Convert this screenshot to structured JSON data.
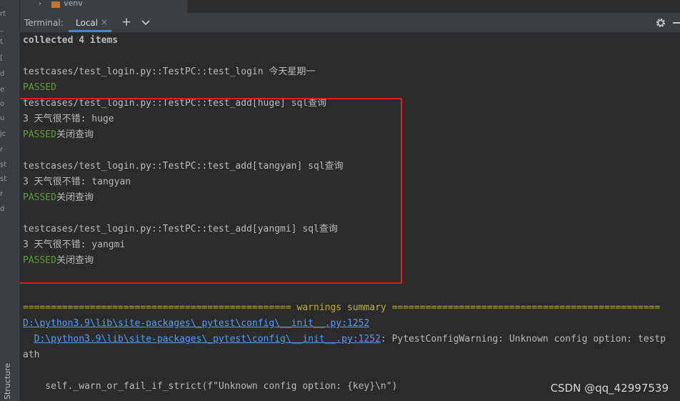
{
  "sidebar_fragments": [
    "rt",
    "_",
    "t",
    "[",
    "d",
    "e",
    "o",
    "u",
    "jc",
    "r",
    "st",
    "st",
    "r",
    "d"
  ],
  "structure_tab": "Structure",
  "project_tree": {
    "folder_name": "venv"
  },
  "tool_window": {
    "title": "Terminal:",
    "active_tab": "Local",
    "close_glyph": "×",
    "add_glyph": "+"
  },
  "terminal": {
    "lines": {
      "collected": "collected 4 items",
      "test1": "testcases/test_login.py::TestPC::test_login 今天星期一",
      "passed1": "PASSED",
      "test2": "testcases/test_login.py::TestPC::test_add[huge] sql查询",
      "weather2": "3 天气很不错: huge",
      "passed2": "PASSED",
      "close2": "关闭查询",
      "test3": "testcases/test_login.py::TestPC::test_add[tangyan] sql查询",
      "weather3": "3 天气很不错: tangyan",
      "passed3": "PASSED",
      "close3": "关闭查询",
      "test4": "testcases/test_login.py::TestPC::test_add[yangmi] sql查询",
      "weather4": "3 天气很不错: yangmi",
      "passed4": "PASSED",
      "close4": "关闭查询",
      "warn_rule_left": "================================================ ",
      "warn_title": "warnings summary",
      "warn_rule_right": " ================================================",
      "path_link1": "D:\\python3.9\\lib\\site-packages\\_pytest\\config\\__init__.py:1252",
      "path_indent": "  ",
      "path_link2": "D:\\python3.9\\lib\\site-packages\\_pytest\\config\\__init__.py:1252",
      "path_warning": ": PytestConfigWarning: Unknown config option: testp",
      "path_wrap": "ath",
      "self_call": "    self._warn_or_fail_if_strict(f\"Unknown config option: {key}\\n\")"
    }
  },
  "watermark": "CSDN @qq_42997539",
  "colors": {
    "background": "#2b2b2b",
    "passed": "#5f9e3b",
    "link": "#589df6",
    "warning": "#bbb529",
    "highlight_box": "#e0201a",
    "tab_underline": "#4a88c7"
  }
}
